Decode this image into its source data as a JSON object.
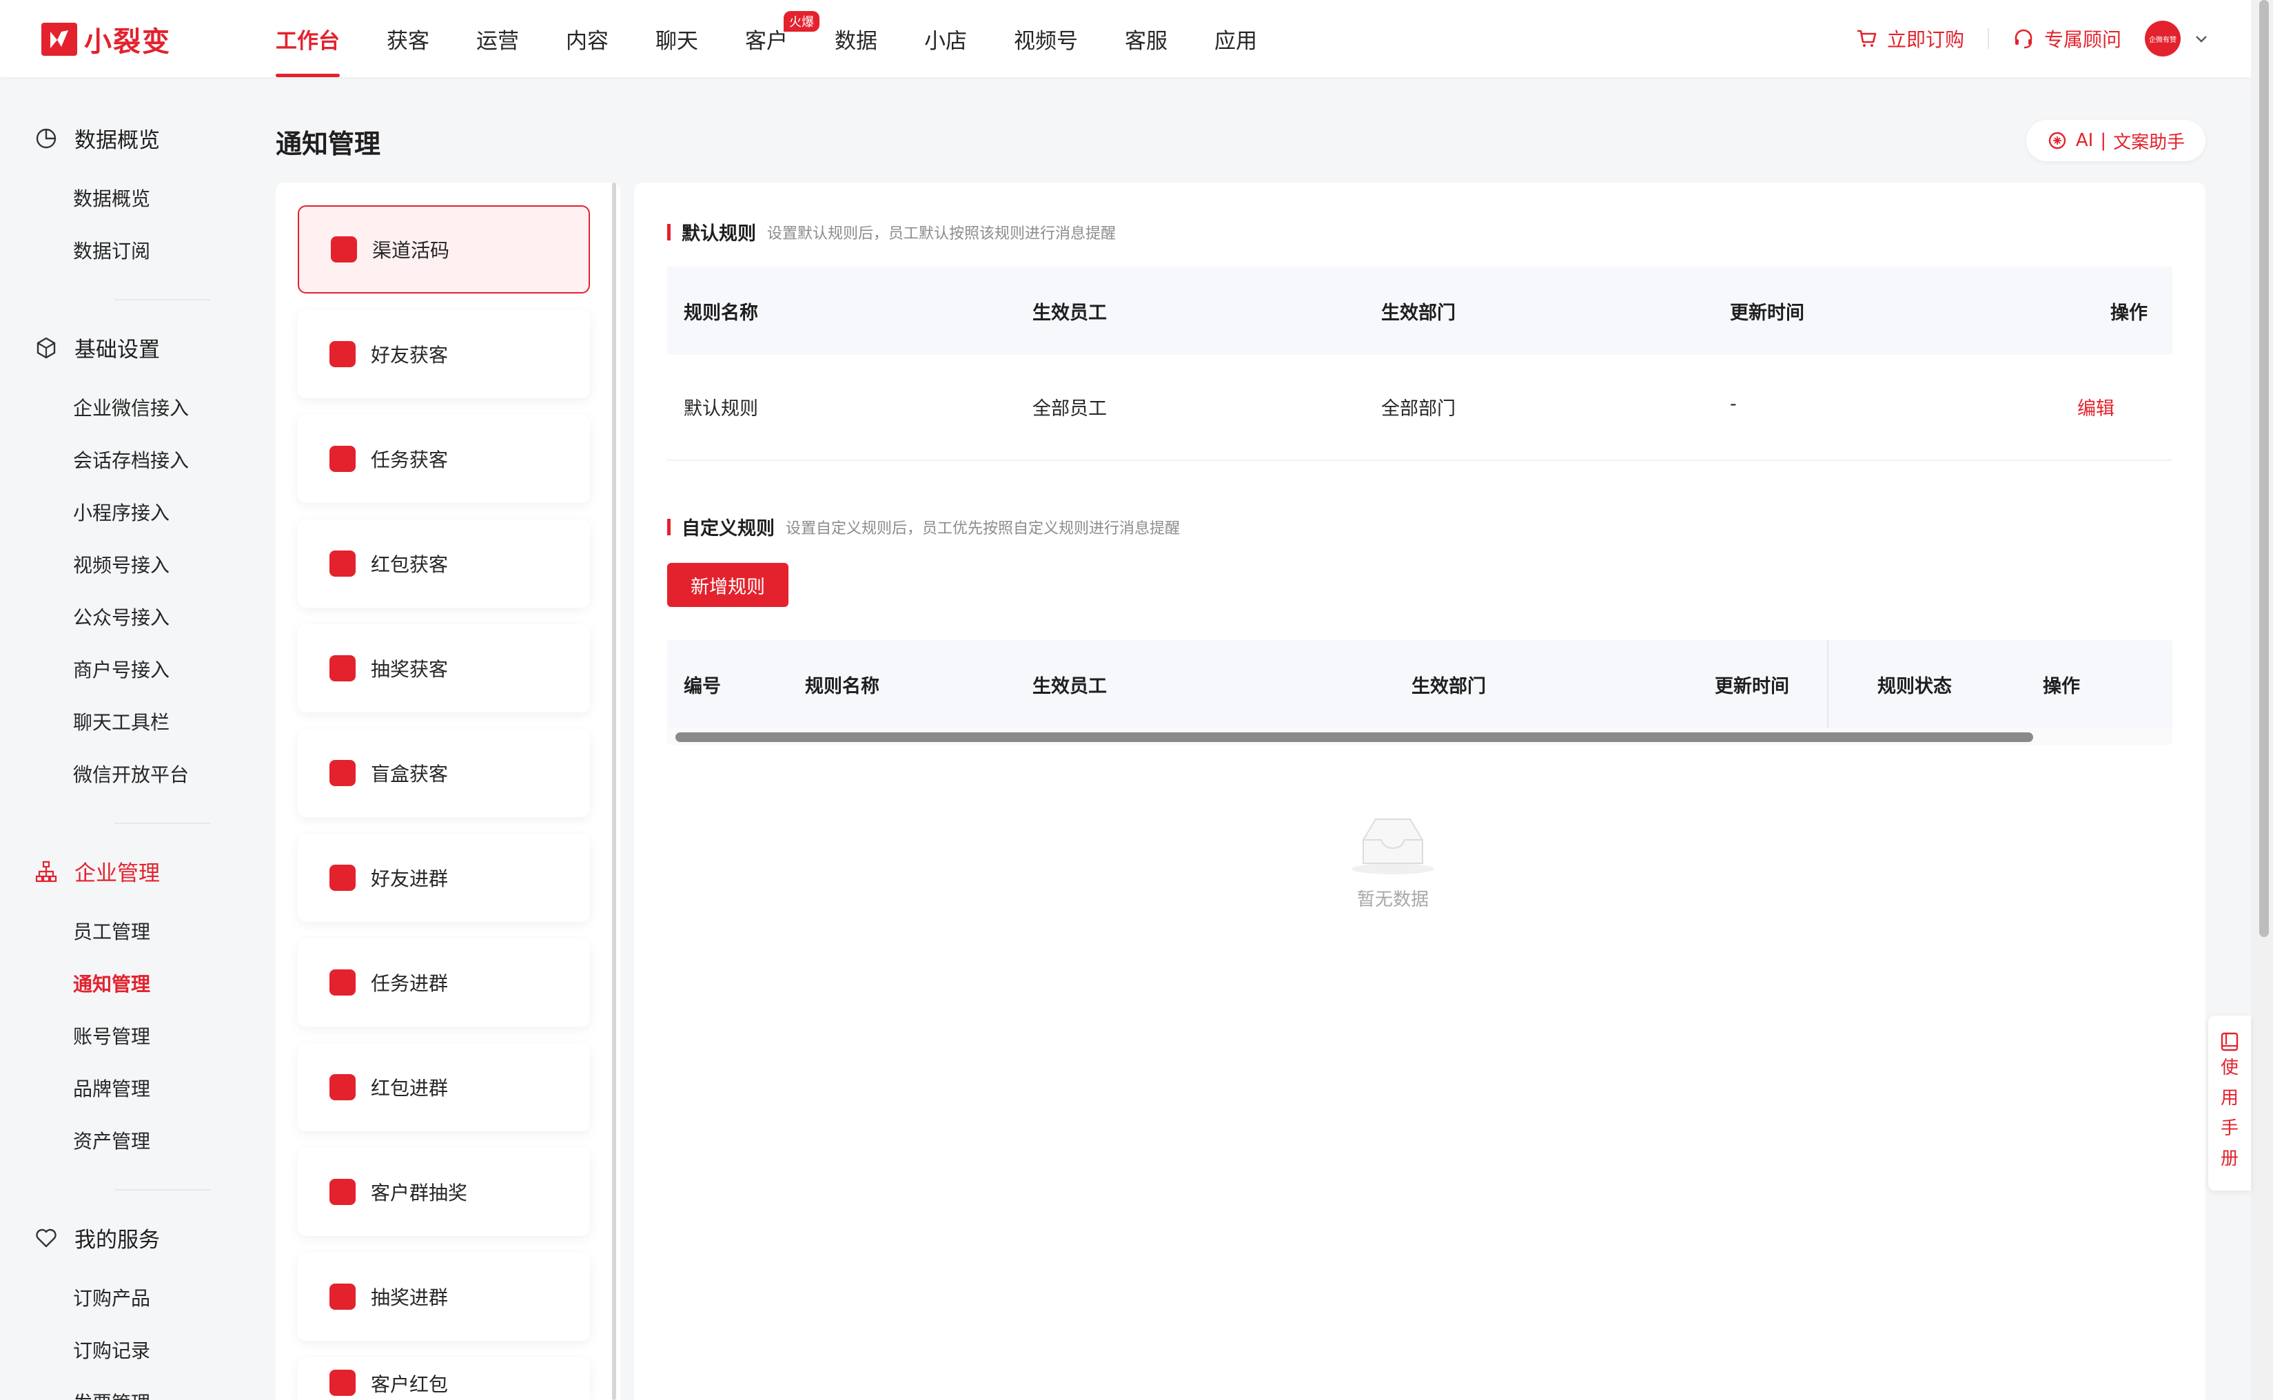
{
  "app": {
    "logo_text": "小裂变",
    "brand_color": "#e3222d"
  },
  "nav": {
    "items": [
      "工作台",
      "获客",
      "运营",
      "内容",
      "聊天",
      "客户",
      "数据",
      "小店",
      "视频号",
      "客服",
      "应用"
    ],
    "active_index": 0,
    "badge": "火爆"
  },
  "top_right": {
    "order_label": "立即订购",
    "advisor_label": "专属顾问",
    "avatar_text": "企微有赞"
  },
  "sidebar": {
    "groups": [
      {
        "label": "数据概览",
        "icon": "pie-chart-icon",
        "items": [
          "数据概览",
          "数据订阅"
        ]
      },
      {
        "label": "基础设置",
        "icon": "cube-icon",
        "items": [
          "企业微信接入",
          "会话存档接入",
          "小程序接入",
          "视频号接入",
          "公众号接入",
          "商户号接入",
          "聊天工具栏",
          "微信开放平台"
        ]
      },
      {
        "label": "企业管理",
        "icon": "org-chart-icon",
        "items": [
          "员工管理",
          "通知管理",
          "账号管理",
          "品牌管理",
          "资产管理"
        ]
      },
      {
        "label": "我的服务",
        "icon": "heart-icon",
        "items": [
          "订购产品",
          "订购记录",
          "发票管理"
        ]
      }
    ],
    "active_item": "通知管理"
  },
  "page": {
    "title": "通知管理",
    "ai_label": "AI",
    "ai_assistant": "文案助手"
  },
  "channels": {
    "items": [
      "渠道活码",
      "好友获客",
      "任务获客",
      "红包获客",
      "抽奖获客",
      "盲盒获客",
      "好友进群",
      "任务进群",
      "红包进群",
      "客户群抽奖",
      "抽奖进群",
      "客户红包"
    ],
    "active_index": 0
  },
  "default_rules": {
    "title": "默认规则",
    "desc": "设置默认规则后，员工默认按照该规则进行消息提醒",
    "columns": [
      "规则名称",
      "生效员工",
      "生效部门",
      "更新时间",
      "操作"
    ],
    "rows": [
      {
        "name": "默认规则",
        "staff": "全部员工",
        "dept": "全部部门",
        "updated": "-",
        "action": "编辑"
      }
    ]
  },
  "custom_rules": {
    "title": "自定义规则",
    "desc": "设置自定义规则后，员工优先按照自定义规则进行消息提醒",
    "add_button": "新增规则",
    "columns": [
      "编号",
      "规则名称",
      "生效员工",
      "生效部门",
      "更新时间",
      "规则状态",
      "操作"
    ],
    "empty_text": "暂无数据"
  },
  "manual": {
    "chars": [
      "使",
      "用",
      "手",
      "册"
    ]
  }
}
